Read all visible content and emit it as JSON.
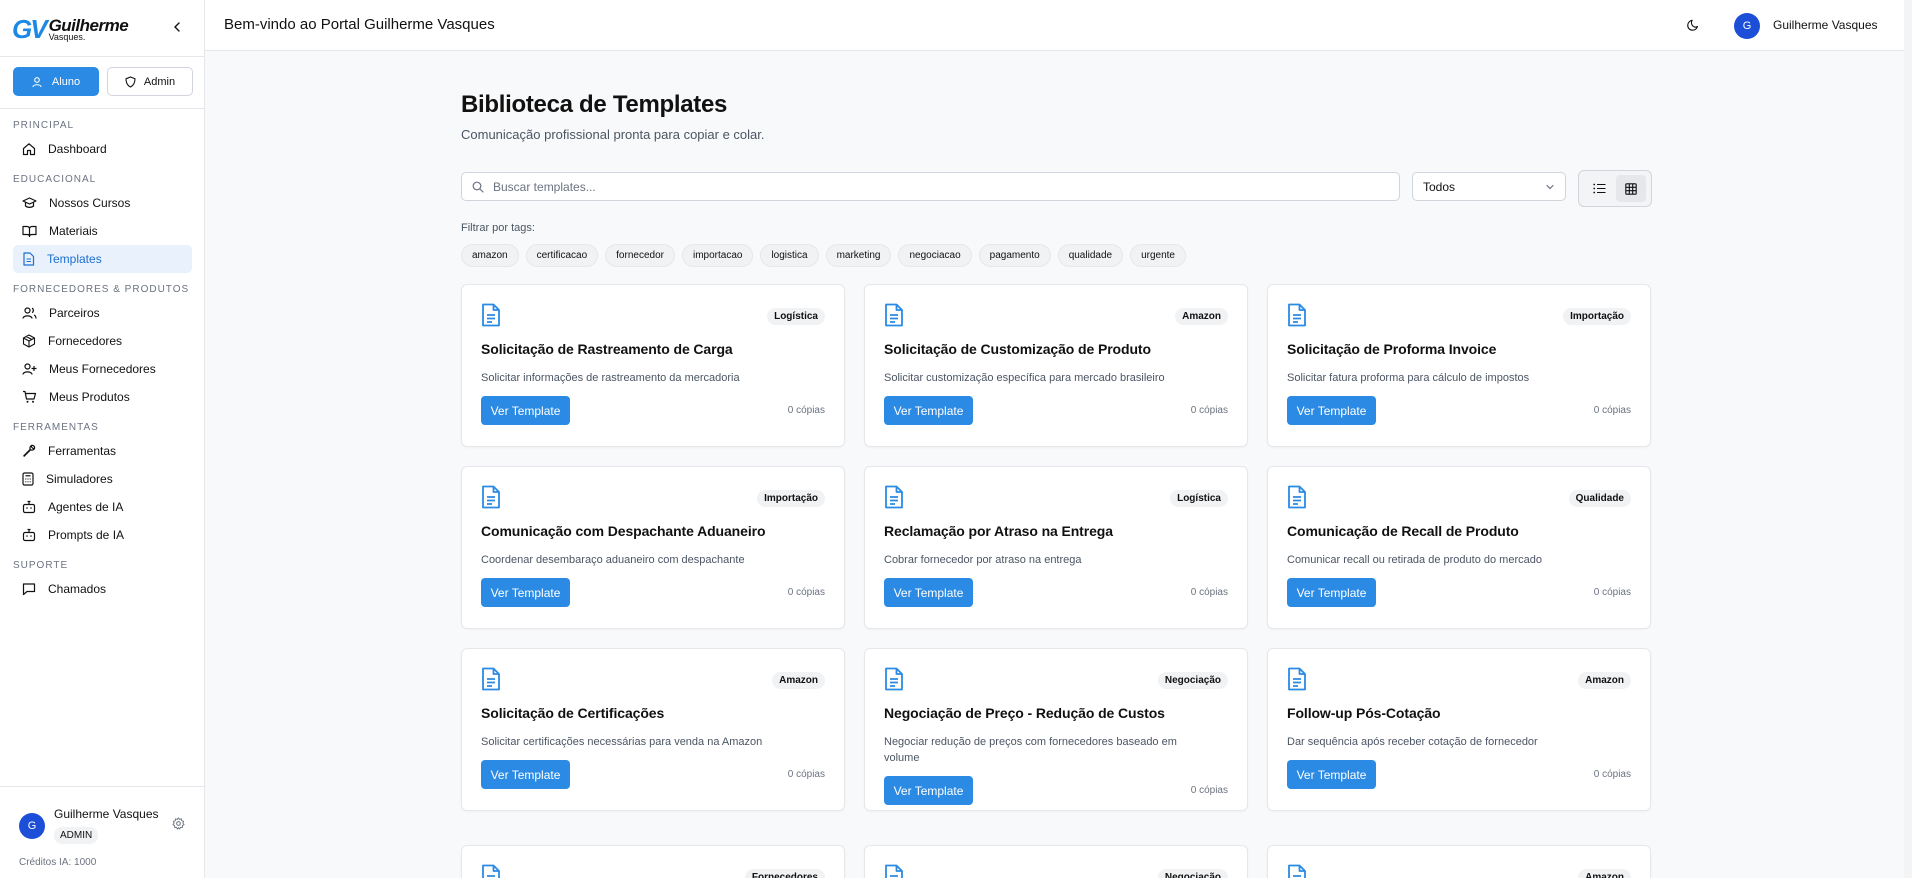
{
  "brand": {
    "mark": "GV",
    "name": "Guilherme",
    "sub": "Vasques."
  },
  "roles": [
    {
      "label": "Aluno",
      "active": true
    },
    {
      "label": "Admin",
      "active": false
    }
  ],
  "nav": {
    "sections": [
      {
        "title": "PRINCIPAL",
        "items": [
          {
            "label": "Dashboard",
            "icon": "home-icon"
          }
        ]
      },
      {
        "title": "EDUCACIONAL",
        "items": [
          {
            "label": "Nossos Cursos",
            "icon": "graduation-cap-icon"
          },
          {
            "label": "Materiais",
            "icon": "book-open-icon"
          },
          {
            "label": "Templates",
            "icon": "file-text-icon",
            "active": true
          }
        ]
      },
      {
        "title": "FORNECEDORES & PRODUTOS",
        "items": [
          {
            "label": "Parceiros",
            "icon": "users-icon"
          },
          {
            "label": "Fornecedores",
            "icon": "package-icon"
          },
          {
            "label": "Meus Fornecedores",
            "icon": "user-plus-icon"
          },
          {
            "label": "Meus Produtos",
            "icon": "shopping-cart-icon"
          }
        ]
      },
      {
        "title": "FERRAMENTAS",
        "items": [
          {
            "label": "Ferramentas",
            "icon": "wrench-icon"
          },
          {
            "label": "Simuladores",
            "icon": "calculator-icon"
          },
          {
            "label": "Agentes de IA",
            "icon": "bot-icon"
          },
          {
            "label": "Prompts de IA",
            "icon": "bot-icon"
          }
        ]
      },
      {
        "title": "SUPORTE",
        "items": [
          {
            "label": "Chamados",
            "icon": "message-square-icon"
          }
        ]
      }
    ]
  },
  "user": {
    "initial": "G",
    "name": "Guilherme Vasques",
    "role": "ADMIN",
    "credits": "Créditos IA: 1000"
  },
  "header": {
    "title": "Bem-vindo ao Portal Guilherme Vasques"
  },
  "page": {
    "title": "Biblioteca de Templates",
    "subtitle": "Comunicação profissional pronta para copiar e colar."
  },
  "search": {
    "placeholder": "Buscar templates..."
  },
  "filter": {
    "selected": "Todos"
  },
  "tags_label": "Filtrar por tags:",
  "tags": [
    "amazon",
    "certificacao",
    "fornecedor",
    "importacao",
    "logistica",
    "marketing",
    "negociacao",
    "pagamento",
    "qualidade",
    "urgente"
  ],
  "button_label": "Ver Template",
  "cards": [
    {
      "badge": "Logística",
      "title": "Solicitação de Rastreamento de Carga",
      "desc": "Solicitar informações de rastreamento da mercadoria",
      "copies": "0 cópias"
    },
    {
      "badge": "Amazon",
      "title": "Solicitação de Customização de Produto",
      "desc": "Solicitar customização específica para mercado brasileiro",
      "copies": "0 cópias"
    },
    {
      "badge": "Importação",
      "title": "Solicitação de Proforma Invoice",
      "desc": "Solicitar fatura proforma para cálculo de impostos",
      "copies": "0 cópias"
    },
    {
      "badge": "Importação",
      "title": "Comunicação com Despachante Aduaneiro",
      "desc": "Coordenar desembaraço aduaneiro com despachante",
      "copies": "0 cópias"
    },
    {
      "badge": "Logística",
      "title": "Reclamação por Atraso na Entrega",
      "desc": "Cobrar fornecedor por atraso na entrega",
      "copies": "0 cópias"
    },
    {
      "badge": "Qualidade",
      "title": "Comunicação de Recall de Produto",
      "desc": "Comunicar recall ou retirada de produto do mercado",
      "copies": "0 cópias"
    },
    {
      "badge": "Amazon",
      "title": "Solicitação de Certificações",
      "desc": "Solicitar certificações necessárias para venda na Amazon",
      "copies": "0 cópias"
    },
    {
      "badge": "Negociação",
      "title": "Negociação de Preço - Redução de Custos",
      "desc": "Negociar redução de preços com fornecedores baseado em volume",
      "copies": "0 cópias"
    },
    {
      "badge": "Amazon",
      "title": "Follow-up Pós-Cotação",
      "desc": "Dar sequência após receber cotação de fornecedor",
      "copies": "0 cópias"
    }
  ],
  "partial_cards": [
    {
      "badge": "Fornecedores"
    },
    {
      "badge": "Negociação"
    },
    {
      "badge": "Amazon"
    }
  ]
}
